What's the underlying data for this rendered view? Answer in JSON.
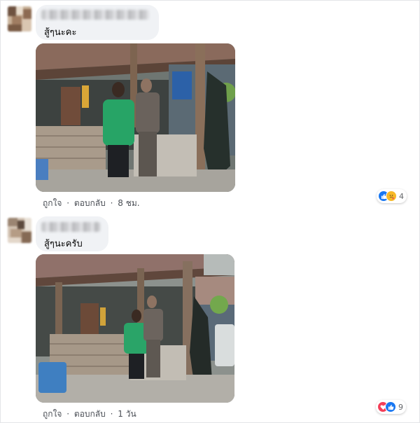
{
  "comments": [
    {
      "text": "สู้ๆนะคะ",
      "actions": {
        "like": "ถูกใจ",
        "reply": "ตอบกลับ",
        "separator": "·",
        "time": "8 ชม."
      },
      "reactions": {
        "icons": [
          "like-icon",
          "care-icon"
        ],
        "count": "4",
        "colors": {
          "like": "#1877f2",
          "care": "#f7b928"
        }
      }
    },
    {
      "text": "สู้ๆนะครับ",
      "actions": {
        "like": "ถูกใจ",
        "reply": "ตอบกลับ",
        "separator": "·",
        "time": "1 วัน"
      },
      "reactions": {
        "icons": [
          "love-icon",
          "like-icon"
        ],
        "count": "9",
        "colors": {
          "love": "#f33e58",
          "like": "#1877f2"
        }
      }
    }
  ]
}
